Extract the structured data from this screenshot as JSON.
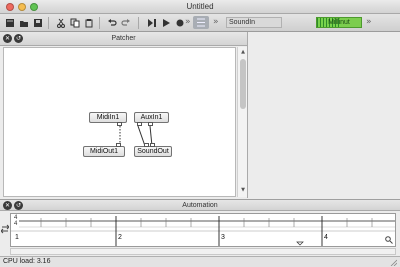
{
  "window": {
    "title": "Untitled"
  },
  "toolbar": {
    "device": "SoundIn",
    "meter_label": "Millinut",
    "meter_level": 0.55,
    "buttons": [
      "new-icon",
      "open-icon",
      "save-icon",
      "cut-icon",
      "copy-icon",
      "paste-icon",
      "undo-icon",
      "redo-icon",
      "play-pause-icon",
      "play-icon",
      "record-icon"
    ],
    "more": "»"
  },
  "patcher": {
    "title": "Patcher",
    "nodes": [
      {
        "label": "MidiIn1"
      },
      {
        "label": "AuxIn1"
      },
      {
        "label": "MidiOut1"
      },
      {
        "label": "SoundOut"
      }
    ]
  },
  "automation": {
    "title": "Automation",
    "row_labels": [
      "4",
      "4"
    ],
    "ruler": [
      "1",
      "2",
      "3",
      "4"
    ]
  },
  "status": {
    "cpu_label": "CPU load: 3.16"
  },
  "colors": {
    "accent": "#7ccd4e",
    "meter_dark": "#2f8a2b"
  }
}
